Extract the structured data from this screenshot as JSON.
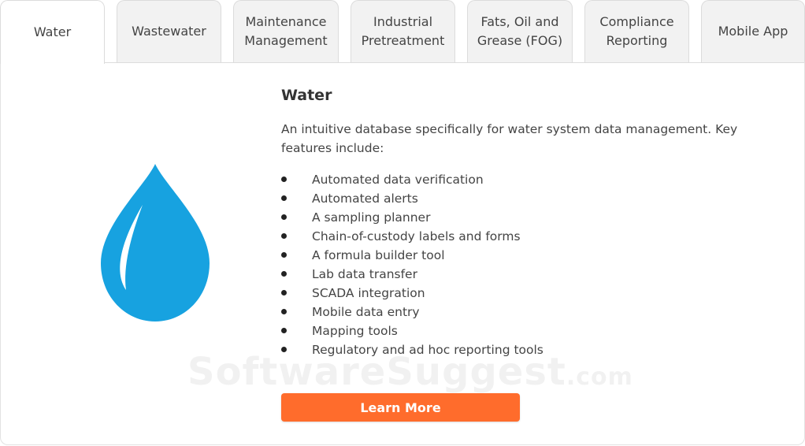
{
  "tabs": [
    {
      "label": "Water",
      "active": true
    },
    {
      "label": "Wastewater"
    },
    {
      "label": "Maintenance\nManagement"
    },
    {
      "label": "Industrial\nPretreatment"
    },
    {
      "label": "Fats, Oil and\nGrease (FOG)"
    },
    {
      "label": "Compliance\nReporting"
    },
    {
      "label": "Mobile App"
    }
  ],
  "panel": {
    "icon": "water-drop-icon",
    "title": "Water",
    "intro": "An intuitive database specifically for water system data management. Key features include:",
    "features": [
      "Automated data verification",
      "Automated alerts",
      "A sampling planner",
      "Chain-of-custody labels and forms",
      "A formula builder tool",
      "Lab data transfer",
      "SCADA integration",
      "Mobile data entry",
      "Mapping tools",
      "Regulatory and ad hoc reporting tools"
    ],
    "button_label": "Learn More"
  },
  "watermark": {
    "main": "SoftwareSuggest",
    "suffix": ".com"
  },
  "colors": {
    "accent": "#ff6c2c",
    "drop": "#17a2e0",
    "tab_bg": "#f2f2f2"
  }
}
